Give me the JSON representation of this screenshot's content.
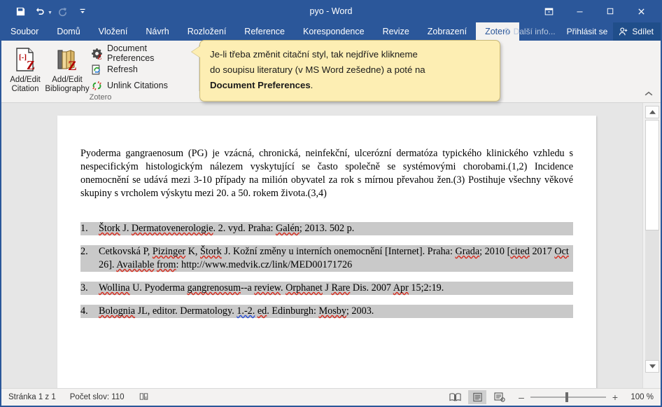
{
  "window": {
    "title": "pyo - Word",
    "quick_access": [
      {
        "name": "save",
        "icon": "save-icon",
        "enabled": true
      },
      {
        "name": "undo",
        "icon": "undo-icon",
        "enabled": true,
        "has_dropdown": true
      },
      {
        "name": "redo",
        "icon": "redo-icon",
        "enabled": false
      },
      {
        "name": "customize-quick-access-toolbar",
        "icon": "chevron-down-icon",
        "enabled": true
      }
    ],
    "controls": [
      {
        "name": "ribbon-display-options",
        "glyph": "⬚"
      },
      {
        "name": "minimize",
        "glyph": "–"
      },
      {
        "name": "maximize",
        "glyph": "☐"
      },
      {
        "name": "close",
        "glyph": "✕"
      }
    ]
  },
  "tabs": [
    {
      "label": "Soubor",
      "active": false
    },
    {
      "label": "Domů",
      "active": false
    },
    {
      "label": "Vložení",
      "active": false
    },
    {
      "label": "Návrh",
      "active": false
    },
    {
      "label": "Rozložení",
      "active": false
    },
    {
      "label": "Reference",
      "active": false
    },
    {
      "label": "Korespondence",
      "active": false
    },
    {
      "label": "Revize",
      "active": false
    },
    {
      "label": "Zobrazení",
      "active": false
    },
    {
      "label": "Zotero",
      "active": true
    }
  ],
  "tab_right": {
    "tell_me": "Další info...",
    "sign_in": "Přihlásit se",
    "share": "Sdílet"
  },
  "ribbon": {
    "group_label": "Zotero",
    "big_buttons": [
      {
        "label_line1": "Add/Edit",
        "label_line2": "Citation",
        "icon": "add-edit-citation-icon"
      },
      {
        "label_line1": "Add/Edit",
        "label_line2": "Bibliography",
        "icon": "add-edit-bibliography-icon"
      }
    ],
    "small_commands": [
      {
        "label": "Document Preferences",
        "icon": "document-preferences-icon"
      },
      {
        "label": "Refresh",
        "icon": "refresh-icon"
      },
      {
        "label": "Unlink Citations",
        "icon": "unlink-citations-icon"
      }
    ],
    "collapse_glyph": "ⱏ"
  },
  "callout": {
    "line1": "Je-li třeba změnit citační styl, tak nejdříve klikneme",
    "line2": "do soupisu literatury (v MS Word zešedne) a poté na",
    "bold_part": "Document Preferences",
    "line3_suffix": ".",
    "background": "#fdeeb3",
    "border": "#c9b97a"
  },
  "document": {
    "paragraph": "Pyoderma gangraenosum (PG) je vzácná, chronická, neinfekční, ulcerózní dermatóza typického klinického vzhledu s nespecifickým histologickým nálezem vyskytující se často společně se systémovými chorobami.(1,2) Incidence onemocnění se udává mezi 3-10 případy na milión obyvatel za rok s mírnou převahou žen.(3) Postihuje všechny věkové skupiny s vrcholem výskytu mezi 20. a 50. rokem života.(3,4)",
    "bibliography": [
      {
        "number": "1.",
        "lines": [
          "Štork J. Dermatovenerologie. 2. vyd. Praha: Galén; 2013. 502 p."
        ]
      },
      {
        "number": "2.",
        "lines": [
          "Cetkovská P, Pizinger K, Štork J. Kožní změny u interních onemocnění [Internet]. Praha: Grada; 2010",
          "[cited 2017 Oct 26]. Available from: http://www.medvik.cz/link/MED00171726"
        ]
      },
      {
        "number": "3.",
        "lines": [
          "Wollina U. Pyoderma gangrenosum--a review. Orphanet J Rare Dis. 2007 Apr 15;2:19."
        ]
      },
      {
        "number": "4.",
        "lines": [
          "Bolognia JL, editor. Dermatology. 1.-2. ed. Edinburgh: Mosby; 2003."
        ]
      }
    ],
    "field_shading_color": "#c9c9c9"
  },
  "statusbar": {
    "page": "Stránka 1 z 1",
    "word_count": "Počet slov: 110",
    "proofing_icon": "proofing-errors-icon",
    "views": [
      {
        "name": "read-mode",
        "icon": "read-mode-icon",
        "active": false
      },
      {
        "name": "print-layout",
        "icon": "print-layout-icon",
        "active": true
      },
      {
        "name": "web-layout",
        "icon": "web-layout-icon",
        "active": false
      }
    ],
    "zoom_out": "–",
    "zoom_in": "+",
    "zoom_level": "100 %"
  }
}
